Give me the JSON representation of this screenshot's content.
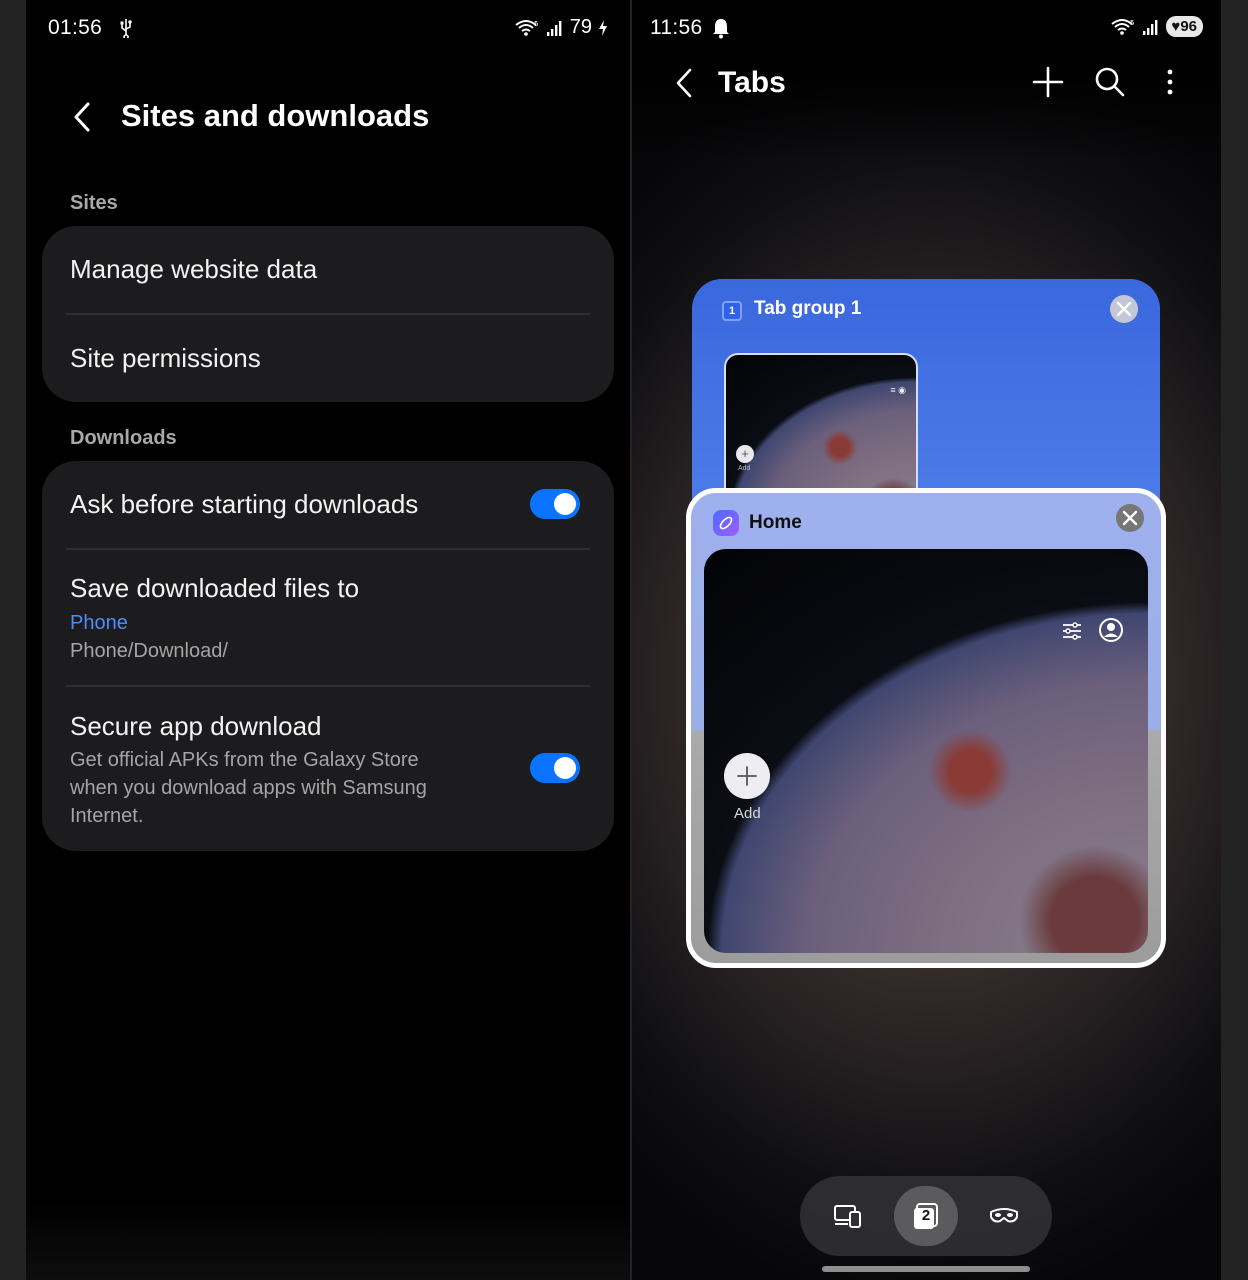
{
  "left": {
    "status": {
      "time": "01:56",
      "battery": "79"
    },
    "title": "Sites and downloads",
    "sections": {
      "sites_label": "Sites",
      "downloads_label": "Downloads"
    },
    "items": {
      "manage_website_data": "Manage website data",
      "site_permissions": "Site permissions",
      "ask_before_downloads": "Ask before starting downloads",
      "ask_before_downloads_enabled": true,
      "save_files_to": "Save downloaded files to",
      "save_location": "Phone",
      "save_path": "Phone/Download/",
      "secure_app_download": "Secure app download",
      "secure_app_download_desc": "Get official APKs from the Galaxy Store when you download apps with Samsung Internet.",
      "secure_app_download_enabled": true
    }
  },
  "right": {
    "status": {
      "time": "11:56",
      "battery": "96"
    },
    "title": "Tabs",
    "tab_group": {
      "badge": "1",
      "title": "Tab group 1"
    },
    "home_tab": {
      "title": "Home",
      "add_label": "Add"
    },
    "bottom_bar": {
      "tab_count": "2"
    }
  },
  "colors": {
    "accent_blue": "#0a73ff",
    "link_blue": "#4c8df6",
    "card_bg": "#1c1c1e",
    "tab_group_blue": "#3a68dd"
  }
}
